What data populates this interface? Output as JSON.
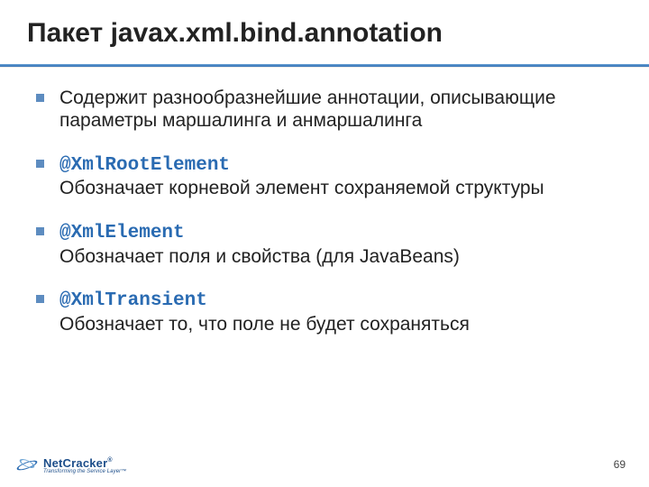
{
  "title": "Пакет javax.xml.bind.annotation",
  "bullets": [
    {
      "code": "",
      "text": "Содержит разнообразнейшие аннотации, описывающие параметры маршалинга и анмаршалинга"
    },
    {
      "code": "@XmlRootElement",
      "text": "Обозначает корневой элемент сохраняемой структуры"
    },
    {
      "code": "@XmlElement",
      "text": "Обозначает поля и свойства (для JavaBeans)"
    },
    {
      "code": "@XmlTransient",
      "text": "Обозначает то, что поле не будет сохраняться"
    }
  ],
  "footer": {
    "brand": "NetCracker",
    "reg": "®",
    "tagline": "Transforming the Service Layer™",
    "page": "69"
  }
}
